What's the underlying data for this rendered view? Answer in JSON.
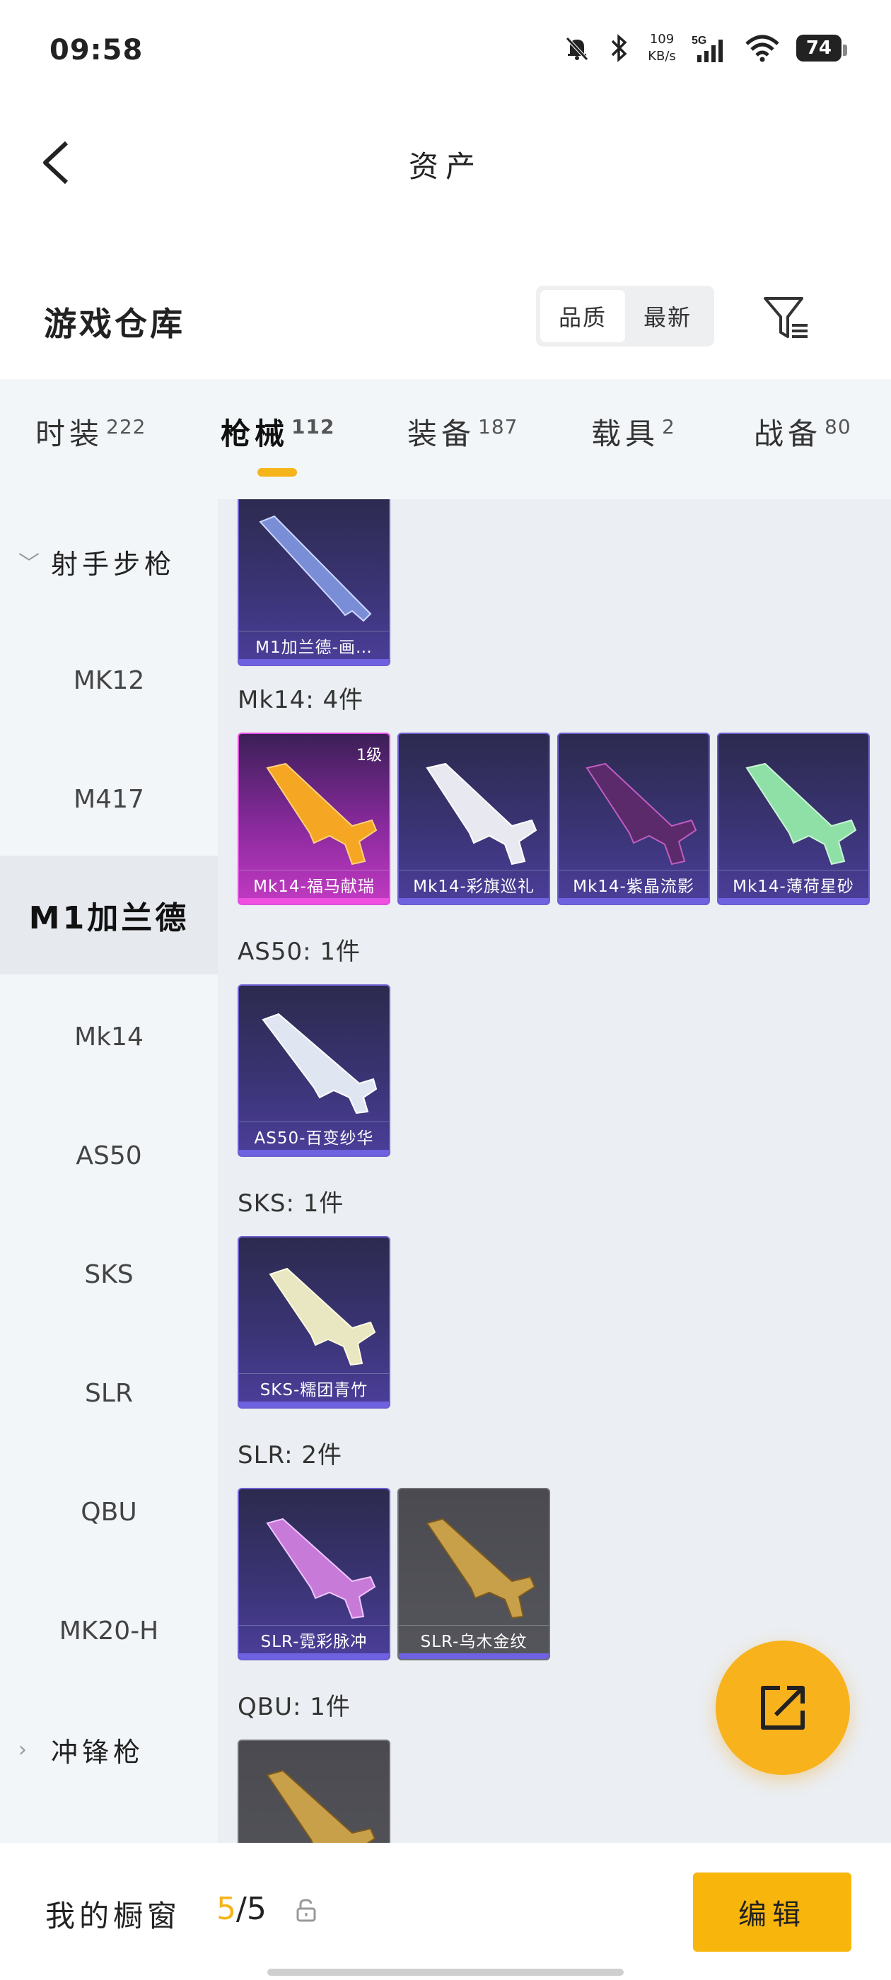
{
  "status_bar": {
    "time": "09:58",
    "net_speed_value": "109",
    "net_speed_unit": "KB/s",
    "signal": "5G",
    "battery": "74"
  },
  "header": {
    "title": "资产"
  },
  "warehouse": {
    "title": "游戏仓库",
    "sort_options": [
      "品质",
      "最新"
    ],
    "sort_selected": "品质"
  },
  "tabs": [
    {
      "label": "时装",
      "count": "222"
    },
    {
      "label": "枪械",
      "count": "112",
      "active": true
    },
    {
      "label": "装备",
      "count": "187"
    },
    {
      "label": "载具",
      "count": "2"
    },
    {
      "label": "战备",
      "count": "80"
    }
  ],
  "sidebar": {
    "group_expanded": "射手步枪",
    "items": [
      "MK12",
      "M417",
      "M1加兰德",
      "Mk14",
      "AS50",
      "SKS",
      "SLR",
      "QBU",
      "MK20-H"
    ],
    "selected": "M1加兰德",
    "group_collapsed": "冲锋枪"
  },
  "content": {
    "top_card": {
      "name": "M1加兰德-画…"
    },
    "groups": [
      {
        "label": "Mk14: 4件",
        "items": [
          {
            "name": "Mk14-福马献瑞",
            "badge": "1级",
            "tier": "pink",
            "color": "#f5a623"
          },
          {
            "name": "Mk14-彩旗巡礼",
            "tier": "purple",
            "color": "#e8e8f0"
          },
          {
            "name": "Mk14-紫晶流影",
            "tier": "purple",
            "color": "#b04fb0"
          },
          {
            "name": "Mk14-薄荷星砂",
            "tier": "purple",
            "color": "#8fe0a6"
          }
        ]
      },
      {
        "label": "AS50: 1件",
        "items": [
          {
            "name": "AS50-百变纱华",
            "tier": "purple",
            "color": "#dfe6f2"
          }
        ]
      },
      {
        "label": "SKS: 1件",
        "items": [
          {
            "name": "SKS-糯团青竹",
            "tier": "purple",
            "color": "#e9e6c2"
          }
        ]
      },
      {
        "label": "SLR: 2件",
        "items": [
          {
            "name": "SLR-霓彩脉冲",
            "tier": "purple",
            "color": "#c77ad8"
          },
          {
            "name": "SLR-乌木金纹",
            "tier": "gray",
            "color": "#c9a04a"
          }
        ]
      },
      {
        "label": "QBU: 1件",
        "items": []
      }
    ]
  },
  "bottom_bar": {
    "window_label": "我的橱窗",
    "window_current": "5",
    "window_total": "/5",
    "edit_label": "编辑"
  },
  "colors": {
    "accent": "#f8b60c",
    "tab_indicator": "#f5b41a",
    "fab": "#f8b21b"
  }
}
